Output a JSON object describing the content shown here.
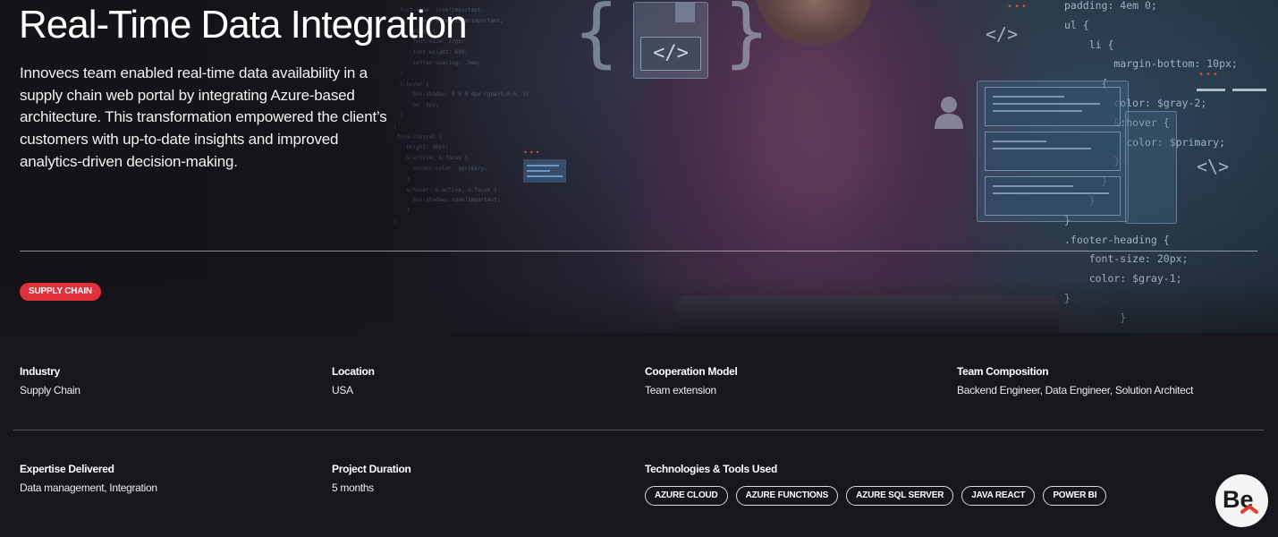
{
  "hero": {
    "title": "Real-Time Data Integration",
    "description": "Innovecs team enabled real-time data availability in a supply chain web portal by integrating Azure-based architecture. This transformation empowered the client’s customers with up-to-date insights and improved analytics-driven decision-making.",
    "tag": "SUPPLY CHAIN",
    "background": {
      "code_right": "padding: 4em 0;\nul {\n    li {\n        margin-bottom: 10px;\n      {\n        color: $gray-2;\n        &:hover {\n          color: $primary;\n        }\n      }\n    }\n}\n.footer-heading {\n    font-size: 20px;\n    color: $gray-1;\n}\n         }",
      "code_left": "  font-size: 1rem!important;\n  .g    font-size: 1rem!important;\n      #logo {\n      font-size: 17px;\n      font-weight: 600;\n      letter-spacing: .5em;\n  }\n  &:hover {\n      box-shadow: 0 0 0 4px rgba(0,0,0,.3)\n      bo  2px;\n  }\n}\n.form-control {\n    height: 40px;\n    &:active, &:focus {\n      border-color: $primary;\n    }\n    &:hover, &:active, &:focus {\n      box-shadow: none!important;\n    }\n}",
      "glyph_code": "</>",
      "glyph_chevrons": "<\\>",
      "brace_left": "{",
      "brace_right": "}"
    }
  },
  "details": {
    "row1": [
      {
        "label": "Industry",
        "value": "Supply Chain"
      },
      {
        "label": "Location",
        "value": "USA"
      },
      {
        "label": "Cooperation Model",
        "value": "Team extension"
      },
      {
        "label": "Team Composition",
        "value": "Backend Engineer, Data Engineer, Solution Architect"
      }
    ],
    "row2": [
      {
        "label": "Expertise Delivered",
        "value": "Data management, Integration"
      },
      {
        "label": "Project Duration",
        "value": "5 months"
      }
    ],
    "tech": {
      "label": "Technologies & Tools Used",
      "items": [
        "AZURE CLOUD",
        "AZURE FUNCTIONS",
        "AZURE SQL SERVER",
        "JAVA REACT",
        "POWER BI"
      ]
    }
  },
  "badge": {
    "icon": "behance-be-logo-icon",
    "text": "Be"
  },
  "colors": {
    "background": "#17161c",
    "tag_red": "#e0313a",
    "text": "#ffffff",
    "badge_bg": "#f4f4f4",
    "badge_accent": "#e33b30"
  }
}
